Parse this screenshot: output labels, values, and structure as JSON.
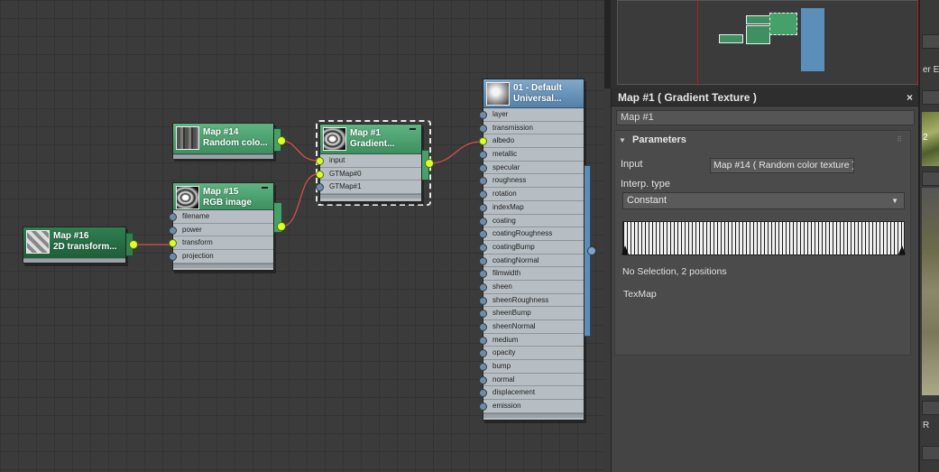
{
  "nodes": {
    "map14": {
      "title_line1": "Map #14",
      "title_line2": "Random  colo..."
    },
    "map15": {
      "title_line1": "Map #15",
      "title_line2": "RGB image",
      "ports": [
        "filename",
        "power",
        "transform",
        "projection"
      ]
    },
    "map16": {
      "title_line1": "Map #16",
      "title_line2": "2D transform..."
    },
    "map1": {
      "title_line1": "Map #1",
      "title_line2": "Gradient...",
      "ports": [
        "input",
        "GTMap#0",
        "GTMap#1"
      ]
    },
    "material": {
      "title_line1": "01 - Default",
      "title_line2": "Universal...",
      "ports": [
        "layer",
        "transmission",
        "albedo",
        "metallic",
        "specular",
        "roughness",
        "rotation",
        "indexMap",
        "coating",
        "coatingRoughness",
        "coatingBump",
        "coatingNormal",
        "filmwidth",
        "sheen",
        "sheenRoughness",
        "sheenBump",
        "sheenNormal",
        "medium",
        "opacity",
        "bump",
        "normal",
        "displacement",
        "emission"
      ]
    }
  },
  "panel": {
    "title": "Map #1  ( Gradient Texture )",
    "close": "×",
    "map_name": "Map #1",
    "section": "Parameters",
    "input_label": "Input",
    "input_value": "Map #14  ( Random color texture )",
    "interp_label": "Interp. type",
    "interp_value": "Constant",
    "selection_text": "No Selection, 2 positions",
    "texmap_label": "TexMap"
  },
  "right_strip": {
    "partial_label_top": "er El",
    "partial_label_mid": "2",
    "partial_label_bottom": "R"
  },
  "colors": {
    "map_node": "#4ea673",
    "material_node": "#6b97bf",
    "active_port": "#d8ff2a",
    "wire": "#e0504a",
    "nav_line": "#c01818"
  }
}
